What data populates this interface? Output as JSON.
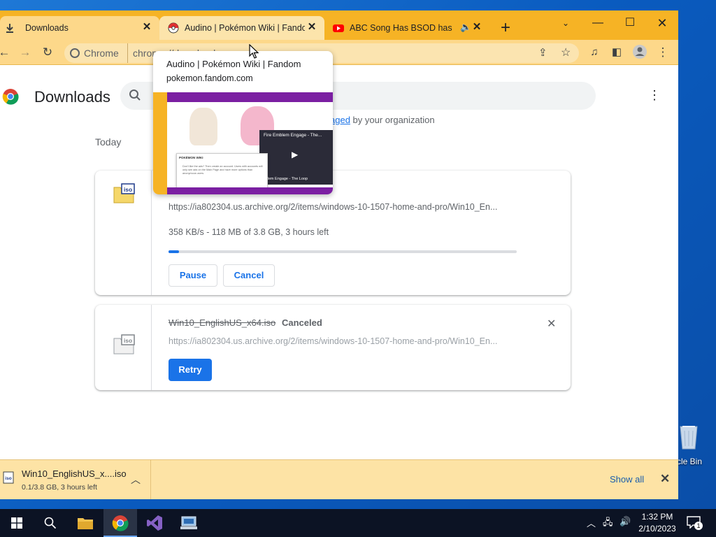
{
  "desktop": {
    "recycle_bin_label": "cle Bin"
  },
  "browser": {
    "tabs": [
      {
        "title": "Downloads",
        "icon": "download-icon"
      },
      {
        "title": "Audino | Pokémon Wiki | Fandom",
        "icon": "fandom-favicon"
      },
      {
        "title": "ABC Song Has BSOD has BSOD",
        "icon": "youtube-favicon"
      }
    ],
    "omnibox": {
      "site_chip": "Chrome",
      "url": "chrome://downloads"
    }
  },
  "downloads_page": {
    "title": "Downloads",
    "managed_prefix": "",
    "managed_link": "aged",
    "managed_suffix": "by your organization",
    "section_label": "Today",
    "items": [
      {
        "file_badge": "iso",
        "source": "https://ia802304.us.archive.org/2/items/windows-10-1507-home-and-pro/Win10_En...",
        "status": "358 KB/s - 118 MB of 3.8 GB, 3 hours left",
        "progress_fraction": 0.031,
        "pause_label": "Pause",
        "cancel_label": "Cancel"
      },
      {
        "file_badge": "iso",
        "filename": "Win10_EnglishUS_x64.iso",
        "state": "Canceled",
        "source": "https://ia802304.us.archive.org/2/items/windows-10-1507-home-and-pro/Win10_En...",
        "retry_label": "Retry"
      }
    ]
  },
  "hover_card": {
    "title": "Audino | Pokémon Wiki | Fandom",
    "host": "pokemon.fandom.com",
    "thumbnail": {
      "video_title": "Fire Emblem Engage - The...",
      "video_caption": "mblem Engage - The Loop",
      "popup_title": "POKÉMON WIKI",
      "popup_text": "Don't like the ads? Then create an account. Users with accounts will only see ads on the Main Page and have more options than anonymous users."
    }
  },
  "download_shelf": {
    "filename": "Win10_EnglishUS_x....iso",
    "size_status": "0.1/3.8 GB, 3 hours left",
    "show_all_label": "Show all"
  },
  "taskbar": {
    "time": "1:32 PM",
    "date": "2/10/2023",
    "notification_count": "1"
  },
  "colors": {
    "tabstrip": "#f6b325",
    "toolbar": "#fdd88a",
    "accent_blue": "#1a73e8",
    "shelf": "#fde3a5"
  }
}
